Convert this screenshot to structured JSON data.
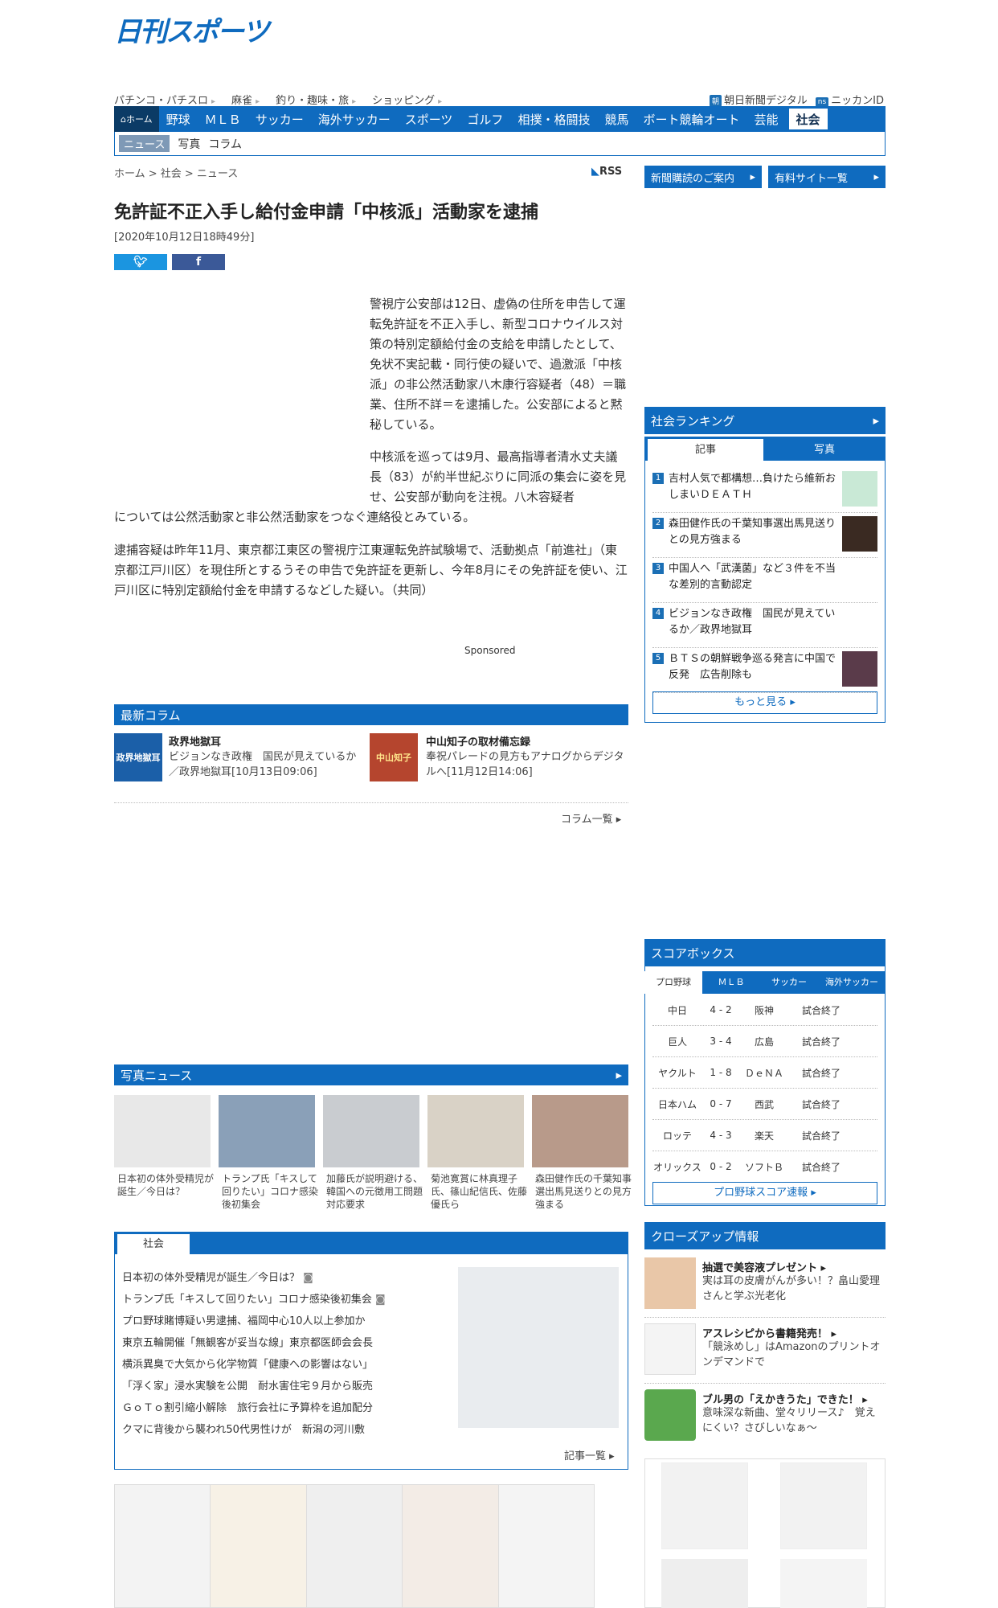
{
  "logo": "日刊スポーツ",
  "topnav": [
    "パチンコ・パチスロ",
    "麻雀",
    "釣り・趣味・旅",
    "ショッピング"
  ],
  "toplinks": [
    {
      "badge": "朝",
      "label": "朝日新聞デジタル"
    },
    {
      "badge": "ns",
      "label": "ニッカンID"
    }
  ],
  "mainnav": {
    "home": "ホーム",
    "items": [
      "野球",
      "ＭＬＢ",
      "サッカー",
      "海外サッカー",
      "スポーツ",
      "ゴルフ",
      "相撲・格闘技",
      "競馬",
      "ボート競輪オート",
      "芸能"
    ],
    "active": "社会"
  },
  "subnav": {
    "active": "ニュース",
    "items": [
      "写真",
      "コラム"
    ]
  },
  "breadcrumb": "ホーム > 社会 > ニュース",
  "rss": "RSS",
  "right_buttons": [
    "新聞購読のご案内",
    "有料サイト一覧"
  ],
  "article": {
    "headline": "免許証不正入手し給付金申請「中核派」活動家を逮捕",
    "date": "[2020年10月12日18時49分]",
    "p1": "警視庁公安部は12日、虚偽の住所を申告して運転免許証を不正入手し、新型コロナウイルス対策の特別定額給付金の支給を申請したとして、免状不実記載・同行使の疑いで、過激派「中核派」の非公然活動家八木康行容疑者（48）＝職業、住所不詳＝を逮捕した。公安部によると黙秘している。",
    "p2": "中核派を巡っては9月、最高指導者清水丈夫議長（83）が約半世紀ぶりに同派の集会に姿を見せ、公安部が動向を注視。八木容疑者",
    "p2b": "については公然活動家と非公然活動家をつなぐ連絡役とみている。",
    "p3": "逮捕容疑は昨年11月、東京都江東区の警視庁江東運転免許試験場で、活動拠点「前進社」（東京都江戸川区）を現住所とするうその申告で免許証を更新し、今年8月にその免許証を使い、江戸川区に特別定額給付金を申請するなどした疑い。（共同）"
  },
  "sponsored": "Sponsored",
  "columns": {
    "header": "最新コラム",
    "items": [
      {
        "title": "政界地獄耳",
        "text": "ビジョンなき政権　国民が見えているか／政界地獄耳[10月13日09:06]",
        "img_label": "政界地獄耳"
      },
      {
        "title": "中山知子の取材備忘録",
        "text": "奉祝パレードの見方もアナログからデジタルへ[11月12日14:06]",
        "img_label": "中山知子"
      }
    ],
    "more": "コラム一覧"
  },
  "photo_news": {
    "header": "写真ニュース",
    "items": [
      "日本初の体外受精児が誕生／今日は？",
      "トランプ氏「キスして回りたい」コロナ感染後初集会",
      "加藤氏が説明避ける、韓国への元徴用工問題対応要求",
      "菊池寛賞に林真理子氏、篠山紀信氏、佐藤優氏ら",
      "森田健作氏の千葉知事選出馬見送りとの見方強まる"
    ]
  },
  "society": {
    "tab": "社会",
    "items": [
      "日本初の体外受精児が誕生／今日は？",
      "トランプ氏「キスして回りたい」コロナ感染後初集会",
      "プロ野球賭博疑い男逮捕、福岡中心10人以上参加か",
      "東京五輪開催「無観客が妥当な線」東京都医師会会長",
      "横浜異臭で大気から化学物質「健康への影響はない」",
      "「浮く家」浸水実験を公開　耐水害住宅９月から販売",
      "ＧｏＴｏ割引縮小解除　旅行会社に予算枠を追加配分",
      "クマに背後から襲われ50代男性けが　新潟の河川敷"
    ],
    "more": "記事一覧"
  },
  "ranking": {
    "header": "社会ランキング",
    "tabs": [
      "記事",
      "写真"
    ],
    "items": [
      "吉村人気で都構想…負けたら維新おしまいＤＥＡＴＨ",
      "森田健作氏の千葉知事選出馬見送りとの見方強まる",
      "中国人へ「武漢菌」など３件を不当な差別的言動認定",
      "ビジョンなき政権　国民が見えているか／政界地獄耳",
      "ＢＴＳの朝鮮戦争巡る発言に中国で反発　広告削除も"
    ],
    "more": "もっと見る"
  },
  "scorebox": {
    "header": "スコアボックス",
    "tabs": [
      "プロ野球",
      "ＭＬＢ",
      "サッカー",
      "海外サッカー"
    ],
    "games": [
      {
        "home": "中日",
        "score": "4 - 2",
        "away": "阪神",
        "status": "試合終了"
      },
      {
        "home": "巨人",
        "score": "3 - 4",
        "away": "広島",
        "status": "試合終了"
      },
      {
        "home": "ヤクルト",
        "score": "1 - 8",
        "away": "ＤｅＮＡ",
        "status": "試合終了"
      },
      {
        "home": "日本ハム",
        "score": "0 - 7",
        "away": "西武",
        "status": "試合終了"
      },
      {
        "home": "ロッテ",
        "score": "4 - 3",
        "away": "楽天",
        "status": "試合終了"
      },
      {
        "home": "オリックス",
        "score": "0 - 2",
        "away": "ソフトＢ",
        "status": "試合終了"
      }
    ],
    "more": "プロ野球スコア速報"
  },
  "closeup": {
    "header": "クローズアップ情報",
    "items": [
      {
        "title": "抽選で美容液プレゼント",
        "text": "実は耳の皮膚がんが多い！？畠山愛理さんと学ぶ光老化"
      },
      {
        "title": "アスレシピから書籍発売！",
        "text": "「競泳めし」はAmazonのプリントオンデマンドで"
      },
      {
        "title": "ブル男の「えかきうた」できた！",
        "text": "意味深な新曲、堂々リリース♪　覚えにくい？さびしいなぁ～"
      }
    ]
  },
  "colors": {
    "brand": "#0f6bbf",
    "dark": "#0b3b66"
  }
}
